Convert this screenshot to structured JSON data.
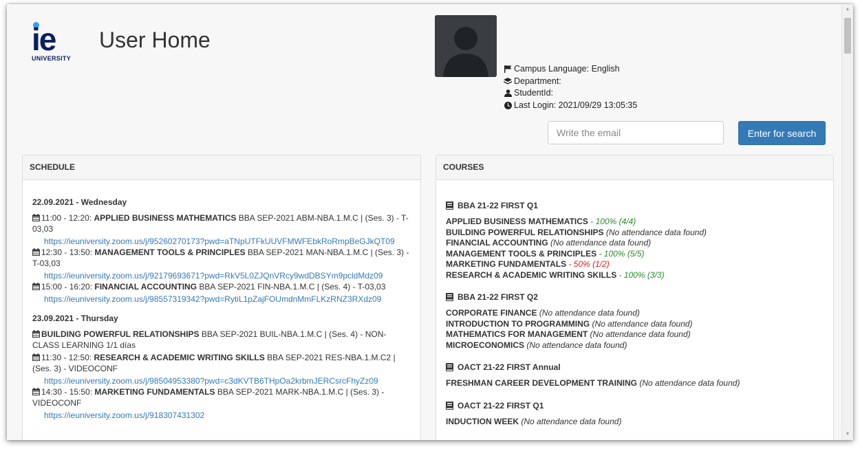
{
  "header": {
    "logo_text": "ie",
    "logo_subtext": "UNIVERSITY",
    "title": "User Home"
  },
  "user_info": {
    "campus_language": "Campus Language: English",
    "department": "Department:",
    "student_id": "StudentId:",
    "last_login": "Last Login: 2021/09/29 13:05:35"
  },
  "search": {
    "placeholder": "Write the email",
    "button_label": "Enter for search"
  },
  "schedule": {
    "heading": "SCHEDULE",
    "days": [
      {
        "date": "22.09.2021 - Wednesday",
        "items": [
          {
            "time": "11:00 - 12:20: ",
            "course": "APPLIED BUSINESS MATHEMATICS",
            "detail": " BBA SEP-2021 ABM-NBA.1.M.C | (Ses. 3) - T-03,03",
            "link": "https://ieuniversity.zoom.us/j/95260270173?pwd=aTNpUTFkUUVFMWFEbkRoRmpBeGJkQT09"
          },
          {
            "time": "12:30 - 13:50: ",
            "course": "MANAGEMENT TOOLS & PRINCIPLES",
            "detail": " BBA SEP-2021 MAN-NBA.1.M.C | (Ses. 3) - T-03,03",
            "link": "https://ieuniversity.zoom.us/j/92179693671?pwd=RkV5L0ZJQnVRcy9wdDBSYm9pcldMdz09"
          },
          {
            "time": "15:00 - 16:20: ",
            "course": "FINANCIAL ACCOUNTING",
            "detail": " BBA SEP-2021 FIN-NBA.1.M.C | (Ses. 4) - T-03,03",
            "link": "https://ieuniversity.zoom.us/j/98557319342?pwd=RytiL1pZajFOUmdnMmFLKzRNZ3RXdz09"
          }
        ]
      },
      {
        "date": "23.09.2021 - Thursday",
        "items": [
          {
            "time": "",
            "course": "BUILDING POWERFUL RELATIONSHIPS",
            "detail": " BBA SEP-2021 BUIL-NBA.1.M.C | (Ses. 4) - NON-CLASS LEARNING 1/1 días",
            "link": ""
          },
          {
            "time": "11:30 - 12:50: ",
            "course": "RESEARCH & ACADEMIC WRITING SKILLS",
            "detail": " BBA SEP-2021 RES-NBA.1.M.C2 | (Ses. 3) - VIDEOCONF",
            "link": "https://ieuniversity.zoom.us/j/98504953380?pwd=c3dKVTB6THpOa2krbmJERCsrcFhyZz09"
          },
          {
            "time": "14:30 - 15:50: ",
            "course": "MARKETING FUNDAMENTALS",
            "detail": " BBA SEP-2021 MARK-NBA.1.M.C | (Ses. 3) - VIDEOCONF",
            "link": "https://ieuniversity.zoom.us/j/918307431302"
          }
        ]
      }
    ]
  },
  "courses": {
    "heading": "COURSES",
    "groups": [
      {
        "title": "BBA 21-22 FIRST Q1",
        "items": [
          {
            "name": "APPLIED BUSINESS MATHEMATICS",
            "note": " - 100% (4/4)",
            "status": "good"
          },
          {
            "name": "BUILDING POWERFUL RELATIONSHIPS",
            "note": " (No attendance data found)",
            "status": "none"
          },
          {
            "name": "FINANCIAL ACCOUNTING",
            "note": " (No attendance data found)",
            "status": "none"
          },
          {
            "name": "MANAGEMENT TOOLS & PRINCIPLES",
            "note": " - 100% (5/5)",
            "status": "good"
          },
          {
            "name": "MARKETING FUNDAMENTALS",
            "note": " - 50% (1/2)",
            "status": "bad"
          },
          {
            "name": "RESEARCH & ACADEMIC WRITING SKILLS",
            "note": " - 100% (3/3)",
            "status": "good"
          }
        ]
      },
      {
        "title": "BBA 21-22 FIRST Q2",
        "items": [
          {
            "name": "CORPORATE FINANCE",
            "note": " (No attendance data found)",
            "status": "none"
          },
          {
            "name": "INTRODUCTION TO PROGRAMMING",
            "note": " (No attendance data found)",
            "status": "none"
          },
          {
            "name": "MATHEMATICS FOR MANAGEMENT",
            "note": " (No attendance data found)",
            "status": "none"
          },
          {
            "name": "MICROECONOMICS",
            "note": " (No attendance data found)",
            "status": "none"
          }
        ]
      },
      {
        "title": "OACT 21-22 FIRST Annual",
        "items": [
          {
            "name": "FRESHMAN CAREER DEVELOPMENT TRAINING",
            "note": " (No attendance data found)",
            "status": "none"
          }
        ]
      },
      {
        "title": "OACT 21-22 FIRST Q1",
        "items": [
          {
            "name": "INDUCTION WEEK",
            "note": " (No attendance data found)",
            "status": "none"
          }
        ]
      }
    ]
  },
  "colors": {
    "primary": "#337ab7",
    "good": "#2a8a2a",
    "bad": "#d9221c",
    "brand": "#0b1e63"
  }
}
